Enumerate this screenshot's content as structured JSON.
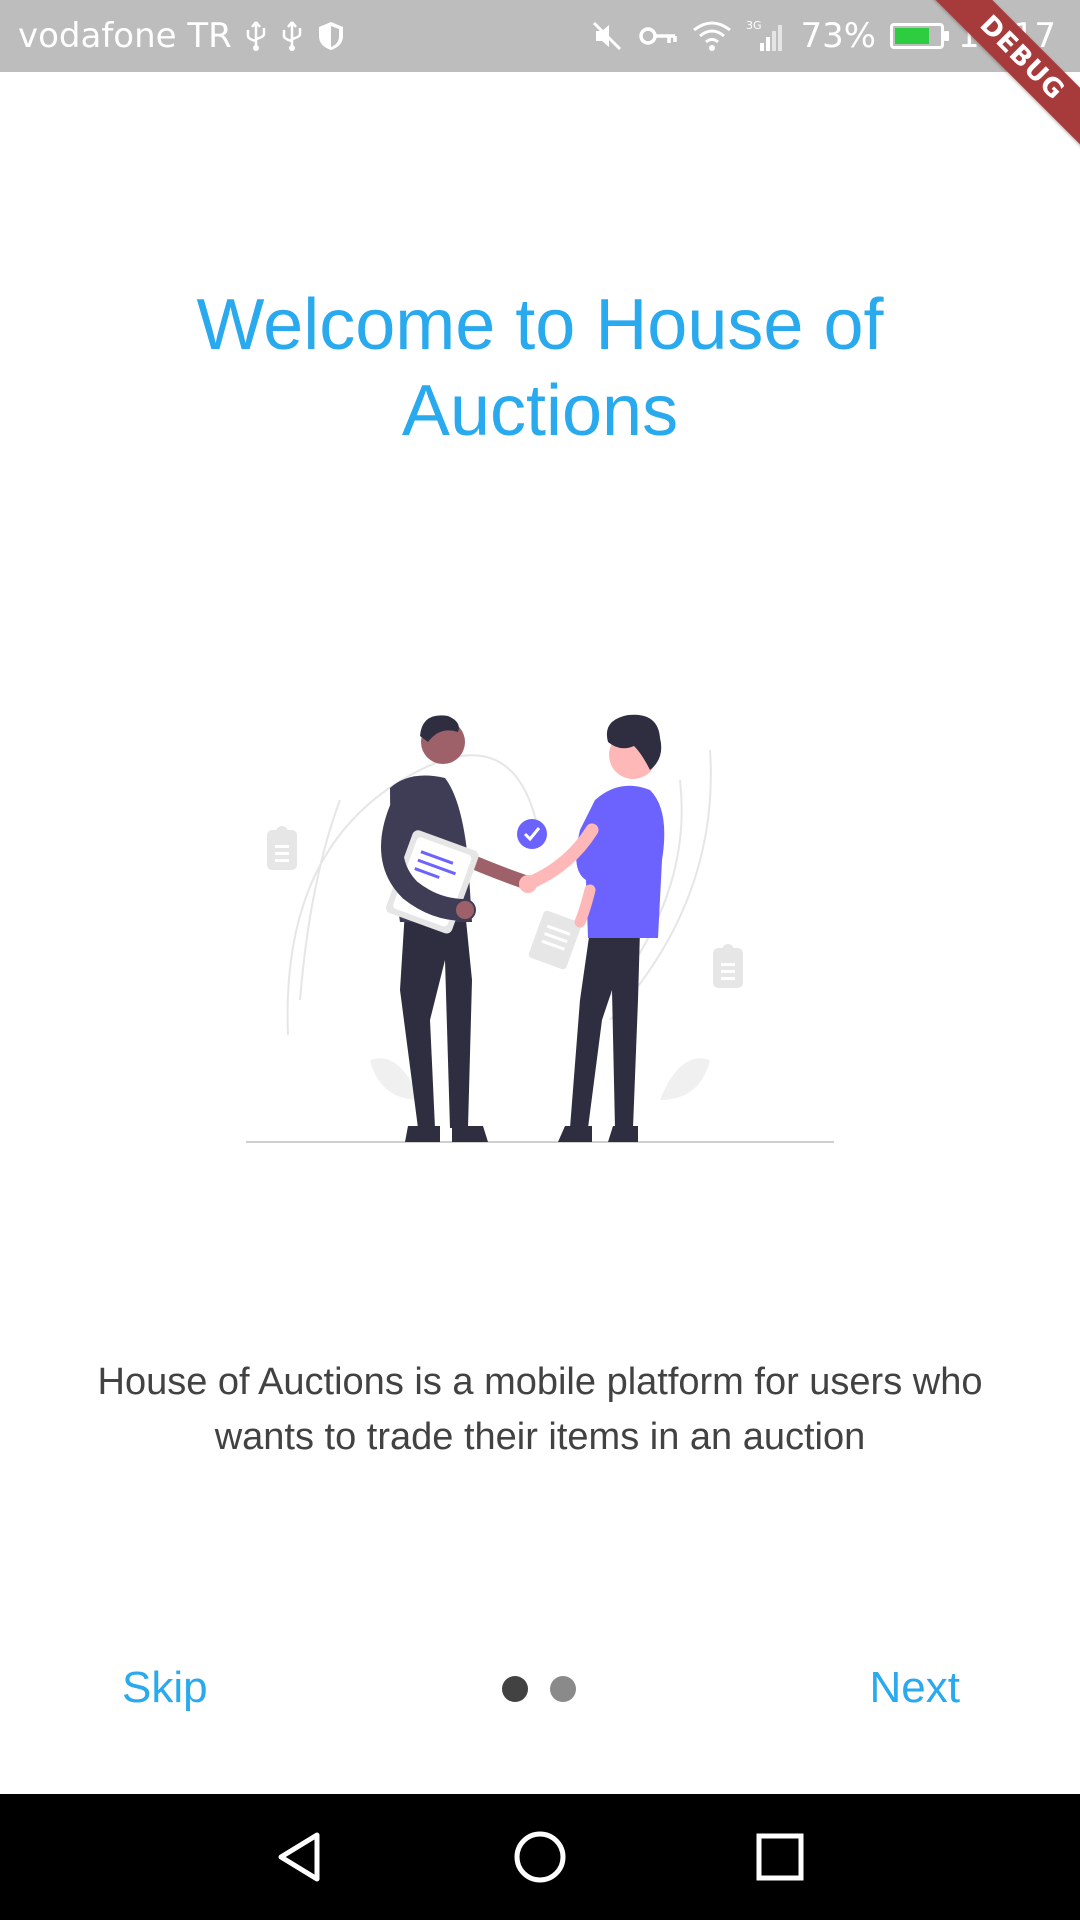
{
  "status_bar": {
    "carrier": "vodafone TR",
    "battery_percent": "73%",
    "time": "19:17",
    "network": "3G",
    "icons": [
      "usb-icon",
      "usb-icon",
      "shield-icon",
      "mute-icon",
      "vpn-key-icon",
      "wifi-icon",
      "signal-icon",
      "battery-icon"
    ],
    "battery_color": "#2ecc40"
  },
  "debug_banner": {
    "label": "DEBUG"
  },
  "onboarding": {
    "title": "Welcome to House of Auctions",
    "illustration": "handshake-illustration",
    "description": "House of Auctions is a mobile platform for users who wants to trade their items in an auction",
    "page_count": 2,
    "current_page": 1
  },
  "navigation": {
    "skip_label": "Skip",
    "next_label": "Next"
  },
  "system_nav": {
    "icons": [
      "back-icon",
      "home-icon",
      "recents-icon"
    ]
  },
  "colors": {
    "accent": "#29a9ee",
    "text": "#424242",
    "status_bar": "#bdbdbd",
    "debug_banner": "#a73a3a",
    "illustration_purple": "#6c63ff",
    "illustration_dark": "#2f2e41"
  }
}
